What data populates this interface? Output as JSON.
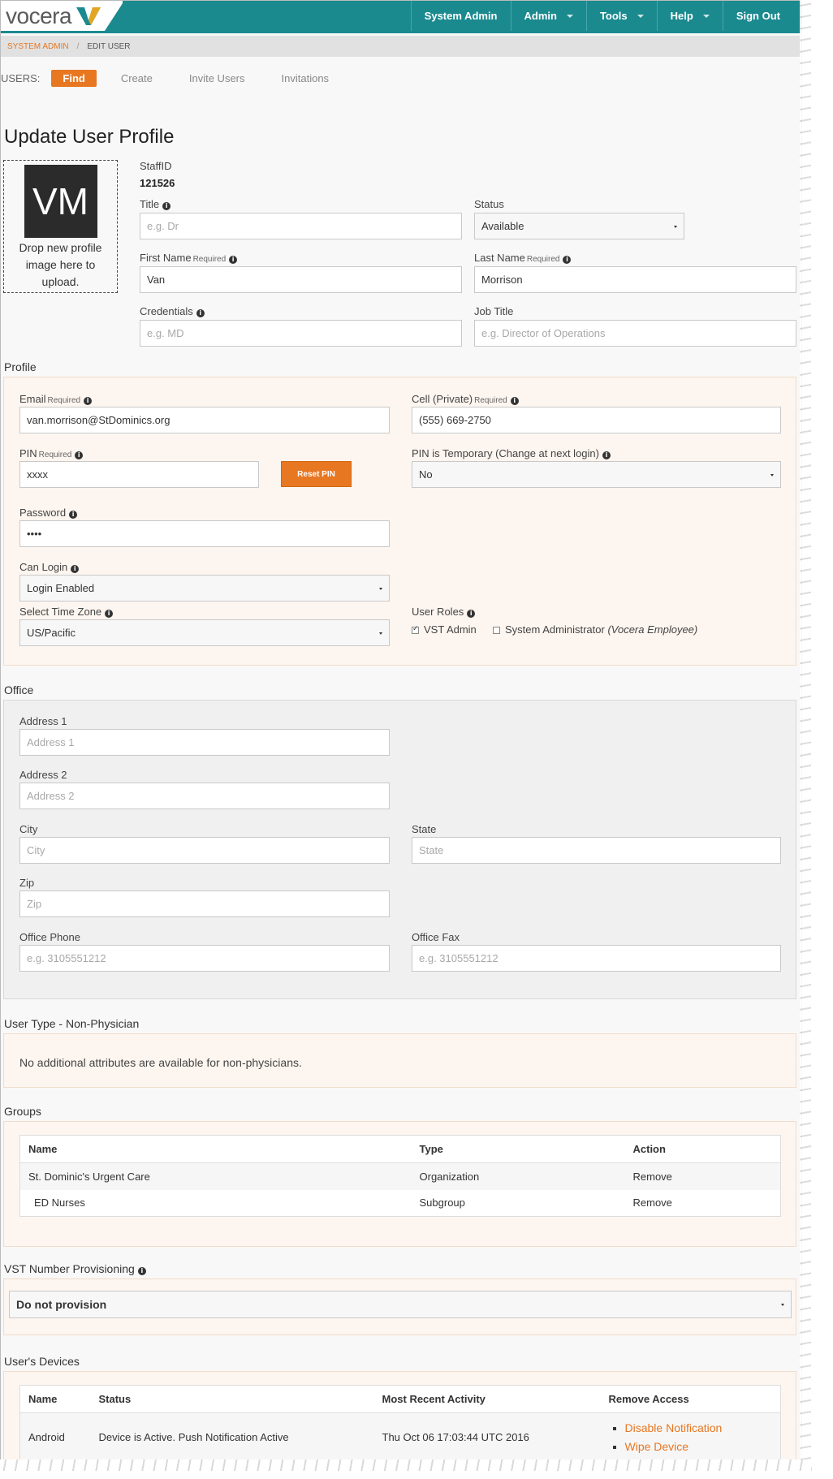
{
  "brand": {
    "name": "vocera"
  },
  "nav": {
    "items": [
      {
        "label": "System Admin",
        "dropdown": false
      },
      {
        "label": "Admin",
        "dropdown": true
      },
      {
        "label": "Tools",
        "dropdown": true
      },
      {
        "label": "Help",
        "dropdown": true
      },
      {
        "label": "Sign Out",
        "dropdown": false
      }
    ]
  },
  "breadcrumb": {
    "parent": "SYSTEM ADMIN",
    "separator": "/",
    "current": "EDIT USER"
  },
  "subnav": {
    "label": "USERS:",
    "active": "Find",
    "links": [
      "Create",
      "Invite Users",
      "Invitations"
    ]
  },
  "page_title": "Update User Profile",
  "photo": {
    "initials": "VM",
    "drop_text": "Drop new profile image here to upload."
  },
  "user": {
    "staffid_label": "StaffID",
    "staffid_value": "121526",
    "title_label": "Title",
    "title_placeholder": "e.g. Dr",
    "status_label": "Status",
    "status_value": "Available",
    "first_name_label": "First Name",
    "first_name_value": "Van",
    "last_name_label": "Last Name",
    "last_name_value": "Morrison",
    "required": "Required",
    "credentials_label": "Credentials",
    "credentials_placeholder": "e.g. MD",
    "job_title_label": "Job Title",
    "job_title_placeholder": "e.g. Director of Operations"
  },
  "profile": {
    "section_title": "Profile",
    "email_label": "Email",
    "email_value": "van.morrison@StDominics.org",
    "cell_label": "Cell (Private)",
    "cell_value": "(555) 669-2750",
    "pin_label": "PIN",
    "pin_value": "xxxx",
    "reset_pin": "Reset PIN",
    "pin_temp_label": "PIN is Temporary (Change at next login)",
    "pin_temp_value": "No",
    "password_label": "Password",
    "password_value": "••••",
    "can_login_label": "Can Login",
    "can_login_value": "Login Enabled",
    "timezone_label": "Select Time Zone",
    "timezone_value": "US/Pacific",
    "roles_label": "User Roles",
    "role_vst_admin": "VST Admin",
    "role_vst_admin_checked": true,
    "role_sysadmin": "System Administrator",
    "role_sysadmin_note": "(Vocera Employee)",
    "role_sysadmin_checked": false
  },
  "office": {
    "section_title": "Office",
    "address1_label": "Address 1",
    "address1_placeholder": "Address 1",
    "address2_label": "Address 2",
    "address2_placeholder": "Address 2",
    "city_label": "City",
    "city_placeholder": "City",
    "state_label": "State",
    "state_placeholder": "State",
    "zip_label": "Zip",
    "zip_placeholder": "Zip",
    "phone_label": "Office Phone",
    "phone_placeholder": "e.g. 3105551212",
    "fax_label": "Office Fax",
    "fax_placeholder": "e.g. 3105551212"
  },
  "user_type": {
    "section_title": "User Type - Non-Physician",
    "message": "No additional attributes are available for non-physicians."
  },
  "groups": {
    "section_title": "Groups",
    "columns": [
      "Name",
      "Type",
      "Action"
    ],
    "rows": [
      {
        "name": "St. Dominic's Urgent Care",
        "type": "Organization",
        "action": "Remove"
      },
      {
        "name": "ED Nurses",
        "type": "Subgroup",
        "action": "Remove"
      }
    ]
  },
  "vst": {
    "section_title": "VST Number Provisioning",
    "value": "Do not provision"
  },
  "devices": {
    "section_title": "User's Devices",
    "columns": [
      "Name",
      "Status",
      "Most Recent Activity",
      "Remove Access"
    ],
    "rows": [
      {
        "name": "Android",
        "status": "Device is Active. Push Notification Active",
        "activity": "Thu Oct 06 17:03:44 UTC 2016",
        "actions": [
          "Disable Notification",
          "Wipe Device"
        ]
      }
    ]
  },
  "colors": {
    "accent": "#e87722",
    "nav": "#1b8a8f"
  }
}
